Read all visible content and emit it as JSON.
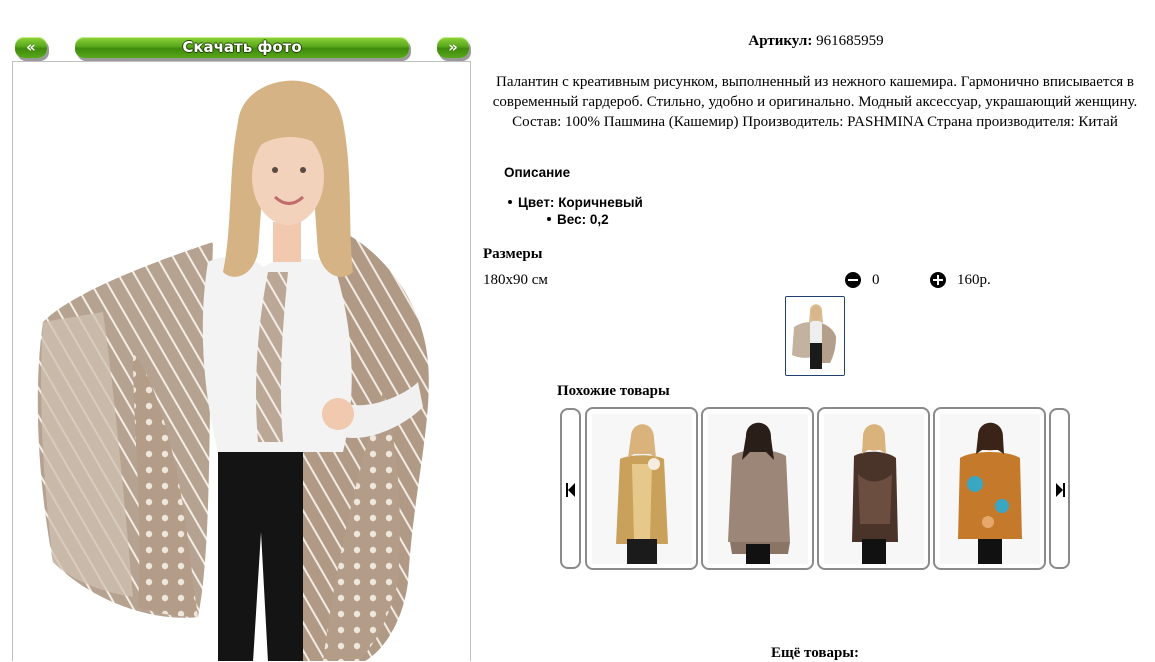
{
  "gallery": {
    "prev_label": "«",
    "download_label": "Скачать фото",
    "next_label": "»"
  },
  "product": {
    "article_label": "Артикул:",
    "article_value": "961685959",
    "description": "Палантин с креативным рисунком, выполненный из нежного кашемира. Гармонично вписывается в современный гардероб. Стильно, удобно и оригинально. Модный аксессуар, украшающий женщину. Состав: 100% Пашмина (Кашемир) Производитель: PASHMINA Страна производителя: Китай",
    "details_title": "Описание",
    "properties": [
      {
        "label": "Цвет:",
        "value": "Коричневый"
      },
      {
        "label": "Вес:",
        "value": "0,2"
      }
    ],
    "sizes_title": "Размеры",
    "size": "180x90 см",
    "quantity": "0",
    "price": "160р."
  },
  "similar": {
    "title": "Похожие товары",
    "items": [
      {
        "color": "#c9a15a"
      },
      {
        "color": "#9c8677"
      },
      {
        "color": "#4a3329"
      },
      {
        "color": "#c47a2a"
      }
    ]
  },
  "more_title": "Ещё товары:",
  "colors": {
    "button_green": "#5aa81c",
    "scarf": "#b09a86",
    "thumb_border": "#1f3f75"
  }
}
